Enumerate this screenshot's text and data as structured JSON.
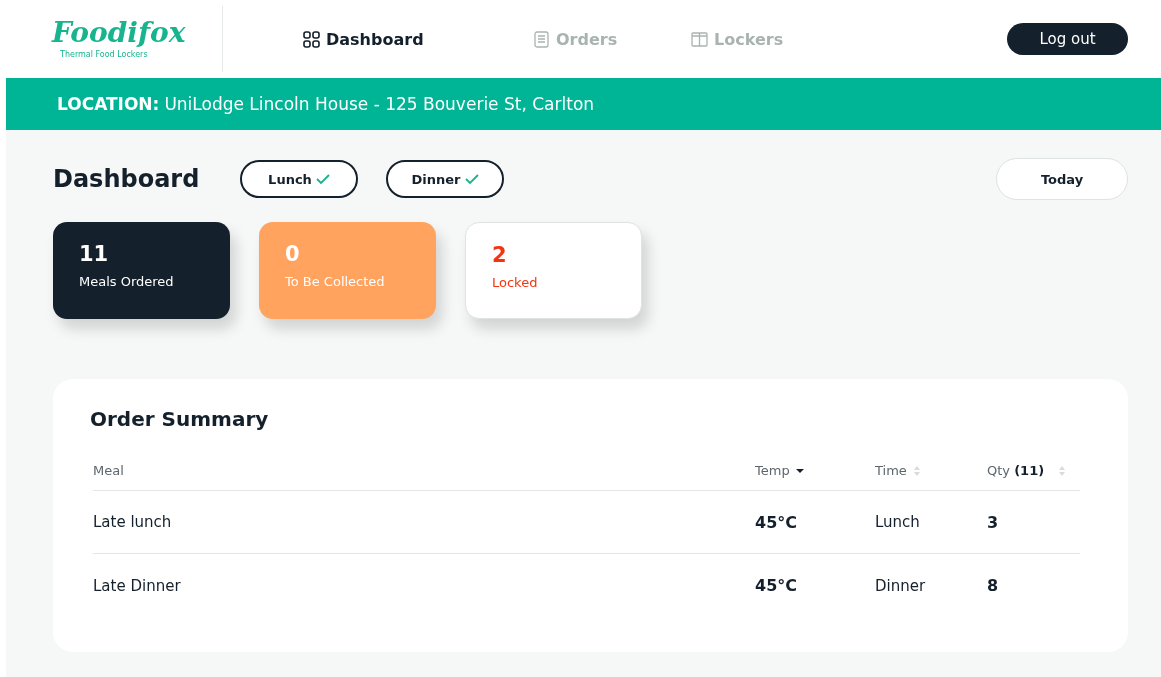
{
  "brand": {
    "name": "Foodifox",
    "tagline": "Thermal Food Lockers"
  },
  "nav": [
    {
      "label": "Dashboard",
      "selected": true
    },
    {
      "label": "Orders",
      "selected": false
    },
    {
      "label": "Lockers",
      "selected": false
    }
  ],
  "logout": "Log out",
  "location": {
    "label": "LOCATION:",
    "value": "UniLodge Lincoln House - 125 Bouverie St, Carlton"
  },
  "page_title": "Dashboard",
  "filters": [
    {
      "label": "Lunch",
      "checked": true
    },
    {
      "label": "Dinner",
      "checked": true
    }
  ],
  "date_button": "Today",
  "stats": [
    {
      "value": "11",
      "label": "Meals Ordered",
      "kind": "dark"
    },
    {
      "value": "0",
      "label": "To Be Collected",
      "kind": "orange"
    },
    {
      "value": "2",
      "label": "Locked",
      "kind": "alert"
    }
  ],
  "order_summary": {
    "title": "Order Summary",
    "columns": [
      {
        "label": "Meal",
        "kind": "plain"
      },
      {
        "label": "Temp",
        "kind": "sorted"
      },
      {
        "label": "Time",
        "kind": "sortable"
      },
      {
        "label": "Qty **(11)**",
        "kind": "sortable"
      }
    ],
    "rows": [
      [
        "Late lunch",
        "45°C",
        "Lunch",
        "3"
      ],
      [
        "Late Dinner",
        "45°C",
        "Dinner",
        "8"
      ]
    ]
  }
}
